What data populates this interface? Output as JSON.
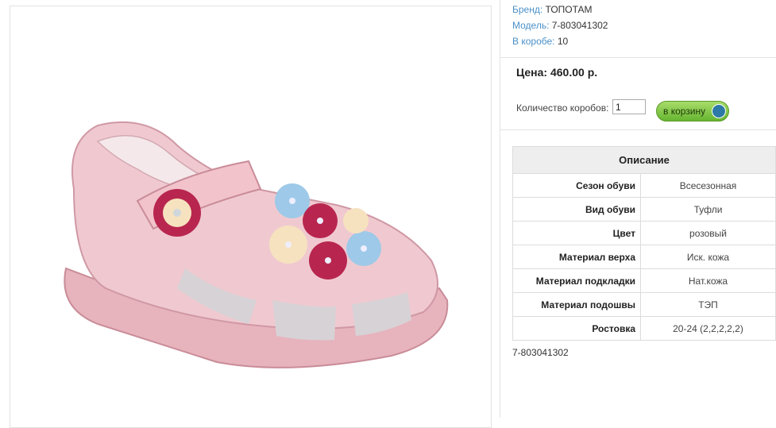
{
  "product": {
    "image_alt": "pink baby sandal with flowers",
    "brand_label": "Бренд:",
    "brand_value": "ТОПОТАМ",
    "model_label": "Модель:",
    "model_value": "7-803041302",
    "box_label": "В коробе:",
    "box_value": "10",
    "price_label": "Цена: 460.00 р.",
    "qty_label": "Количество коробов:",
    "qty_value": "1",
    "cart_button": "в корзину",
    "article_code": "7-803041302"
  },
  "description": {
    "title": "Описание",
    "rows": [
      {
        "key": "Сезон обуви",
        "value": "Всесезонная"
      },
      {
        "key": "Вид обуви",
        "value": "Туфли"
      },
      {
        "key": "Цвет",
        "value": "розовый"
      },
      {
        "key": "Материал верха",
        "value": "Иск. кожа"
      },
      {
        "key": "Материал подкладки",
        "value": "Нат.кожа"
      },
      {
        "key": "Материал подошвы",
        "value": "ТЭП"
      },
      {
        "key": "Ростовка",
        "value": "20-24 (2,2,2,2,2)"
      }
    ]
  },
  "colors": {
    "label_blue": "#4a90c8",
    "button_green": "#66b530",
    "shoe_pink": "#e8b7bf"
  }
}
